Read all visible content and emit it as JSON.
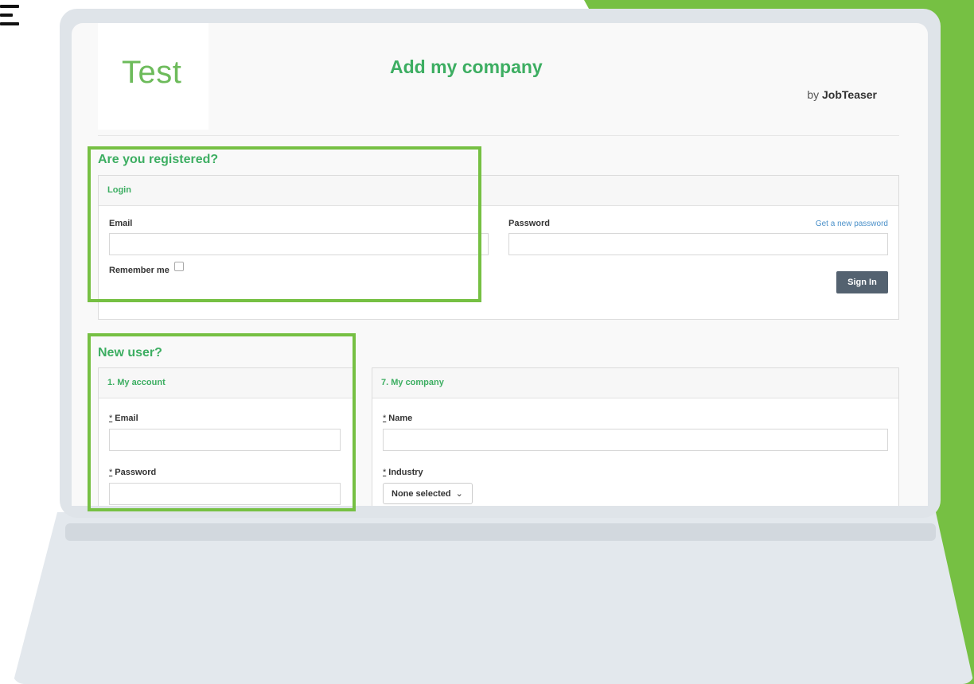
{
  "header": {
    "logo_text": "Test",
    "title": "Add my company",
    "by_prefix": "by",
    "brand": "JobTeaser"
  },
  "login_section": {
    "heading": "Are you registered?",
    "panel_title": "Login",
    "email_label": "Email",
    "email_value": "",
    "password_label": "Password",
    "password_value": "",
    "forgot_link": "Get a new password",
    "remember_label": "Remember me",
    "sign_in_label": "Sign In"
  },
  "signup_section": {
    "heading": "New user?",
    "account_panel": {
      "title": "1. My account",
      "required_mark": "*",
      "email_label": "Email",
      "password_label": "Password"
    },
    "company_panel": {
      "title": "7. My company",
      "required_mark": "*",
      "name_label": "Name",
      "industry_label": "Industry",
      "industry_value": "None selected"
    }
  },
  "colors": {
    "accent_green": "#3dae62",
    "highlight_green": "#76c043",
    "button_dark": "#546270",
    "link_blue": "#4a90c9"
  },
  "icons": {
    "dropdown": "chevron-down-icon",
    "corner": "menu-icon"
  }
}
